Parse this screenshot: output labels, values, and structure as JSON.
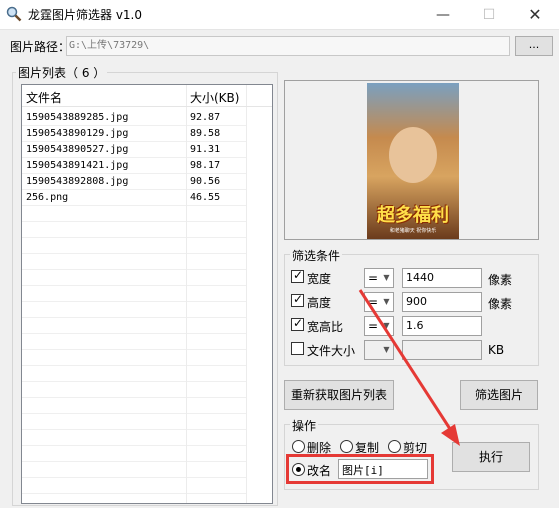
{
  "window": {
    "title": "龙霆图片筛选器 v1.0",
    "minimize": "—",
    "maximize": "☐",
    "close": "✕"
  },
  "path": {
    "label": "图片路径：",
    "value": "G:\\上传\\73729\\",
    "browse_label": "..."
  },
  "list": {
    "group_title": "图片列表（ 6 ）",
    "columns": [
      "文件名",
      "大小(KB)"
    ],
    "rows": [
      [
        "1590543889285.jpg",
        "92.87"
      ],
      [
        "1590543890129.jpg",
        "89.58"
      ],
      [
        "1590543890527.jpg",
        "91.31"
      ],
      [
        "1590543891421.jpg",
        "98.17"
      ],
      [
        "1590543892808.jpg",
        "90.56"
      ],
      [
        "256.png",
        "46.55"
      ]
    ]
  },
  "preview": {
    "poster_title": "超多福利",
    "poster_sub": "和老猪聊天 祝你快乐"
  },
  "filter": {
    "group_title": "筛选条件",
    "width": {
      "label": "宽度",
      "checked": true,
      "op": "=",
      "value": "1440",
      "unit": "像素"
    },
    "height": {
      "label": "高度",
      "checked": true,
      "op": "=",
      "value": "900",
      "unit": "像素"
    },
    "ratio": {
      "label": "宽高比",
      "checked": true,
      "op": "=",
      "value": "1.6"
    },
    "filesize": {
      "label": "文件大小",
      "checked": false,
      "op": "",
      "value": "",
      "unit": "KB"
    }
  },
  "buttons": {
    "refresh": "重新获取图片列表",
    "filter": "筛选图片",
    "execute": "执行"
  },
  "ops": {
    "group_title": "操作",
    "delete": "删除",
    "copy": "复制",
    "cut": "剪切",
    "rename": "改名",
    "rename_pattern": "图片[i]",
    "selected": "rename"
  },
  "colors": {
    "annotation": "#e53935"
  }
}
